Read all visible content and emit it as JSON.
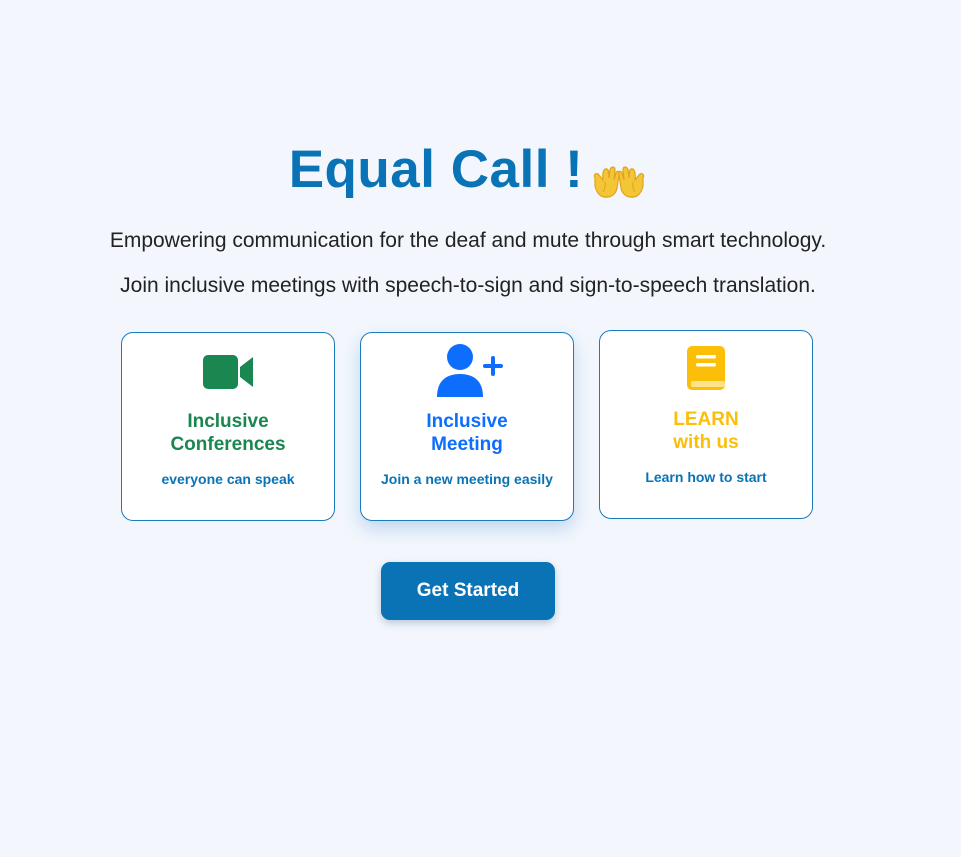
{
  "hero": {
    "title": "Equal Call !",
    "title_icon": "open-hands-icon",
    "subtitle_1": "Empowering communication for the deaf and mute through smart technology.",
    "subtitle_2": "Join inclusive meetings with speech-to-sign and sign-to-speech translation."
  },
  "cards": [
    {
      "icon": "video-camera-icon",
      "title_line1": "Inclusive",
      "title_line2": "Conferences",
      "subtitle": "everyone can speak",
      "color": "#1a8751"
    },
    {
      "icon": "add-user-icon",
      "title_line1": "Inclusive",
      "title_line2": "Meeting",
      "subtitle": "Join a new meeting easily",
      "color": "#0d6efd"
    },
    {
      "icon": "book-icon",
      "title_line1": "LEARN",
      "title_line2": "with us",
      "subtitle": "Learn how to start",
      "color": "#fbbf0a"
    }
  ],
  "cta": {
    "label": "Get Started"
  },
  "colors": {
    "background": "#f3f7fd",
    "accent": "#0a73b5",
    "text": "#222222"
  }
}
